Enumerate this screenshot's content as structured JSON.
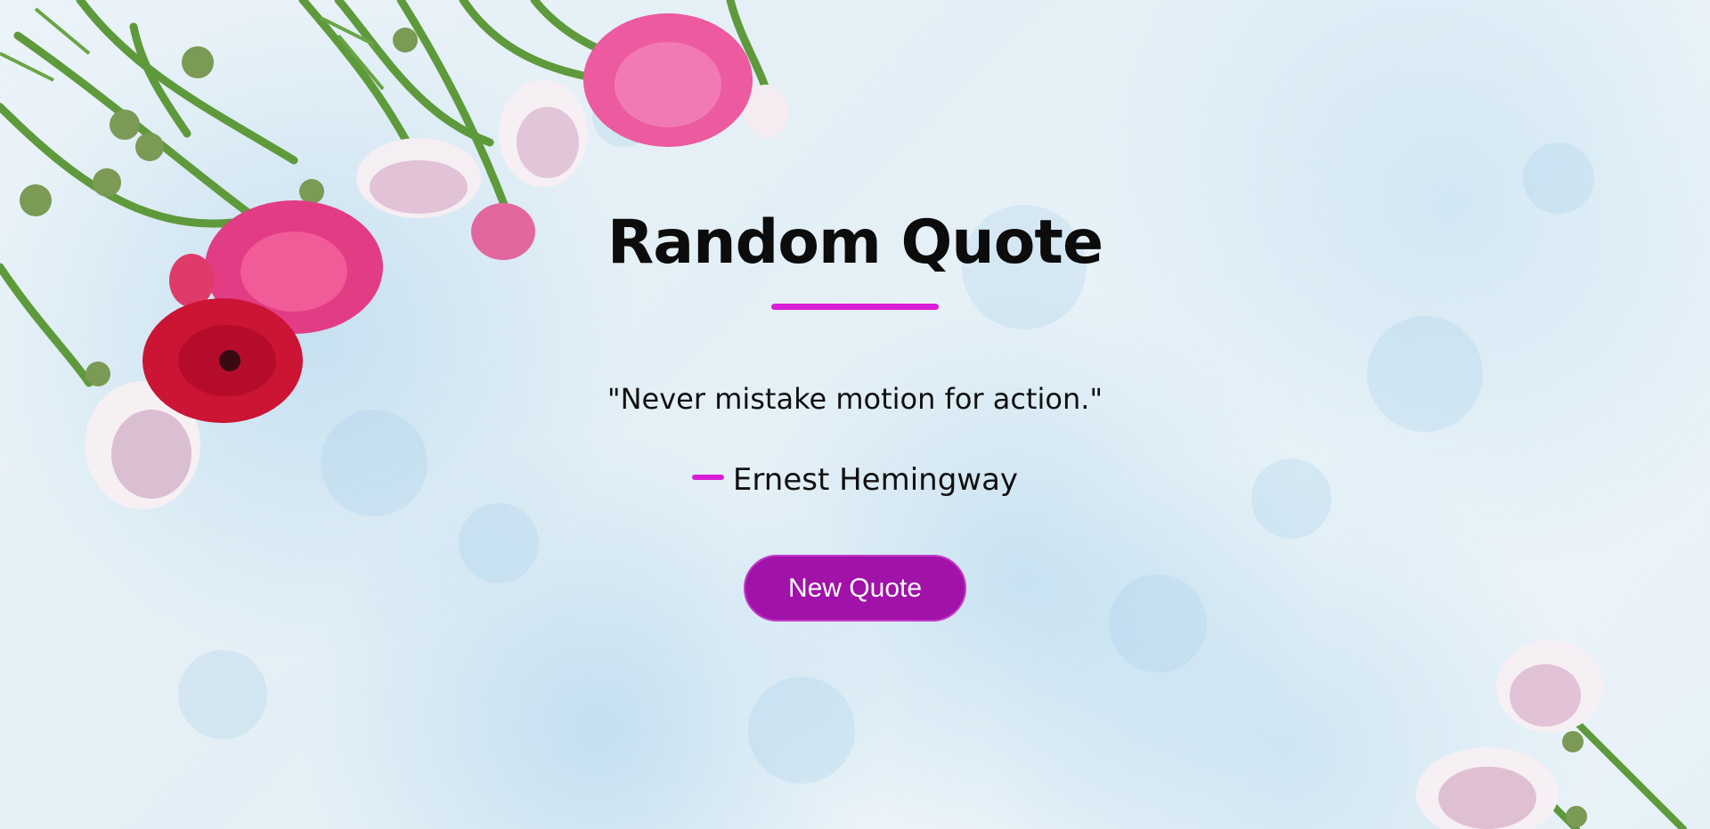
{
  "page": {
    "title": "Random Quote",
    "accent_color": "#d91ed6",
    "button_color": "#a012a8",
    "background": "light blue textured surface with ranunculus flowers"
  },
  "quote": {
    "text": "\"Never mistake motion for action.\"",
    "author": "Ernest Hemingway"
  },
  "actions": {
    "new_quote_label": "New Quote"
  },
  "decor": {
    "flowers_top_left_icon": "ranunculus-flowers-icon",
    "flowers_bottom_right_icon": "ranunculus-flowers-icon"
  }
}
